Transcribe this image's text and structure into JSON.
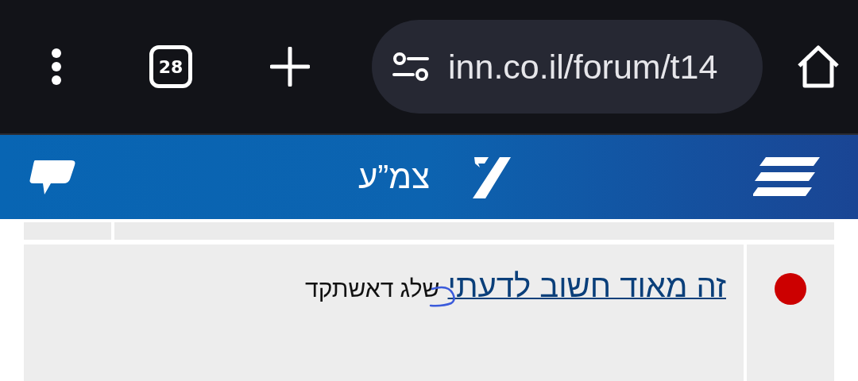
{
  "browser": {
    "tab_count": "28",
    "url": "inn.co.il/forum/t14"
  },
  "header": {
    "title": "צמ”ע"
  },
  "posts": [
    {
      "title": "זה מאוד חשוב לדעתי",
      "author": "שלג דאשתקד",
      "color": "#cc0000"
    }
  ]
}
